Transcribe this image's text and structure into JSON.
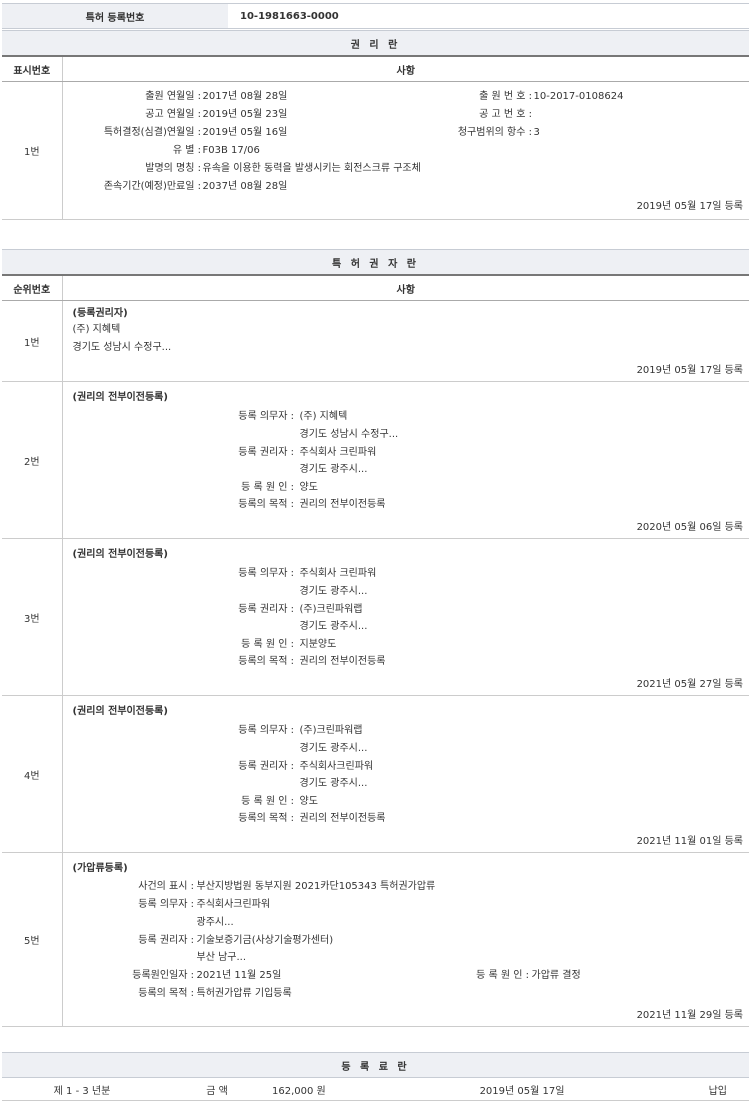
{
  "reg": {
    "label": "특허 등록번호",
    "value": "10-1981663-0000"
  },
  "rights": {
    "title": "권 리 란",
    "col1": "표시번호",
    "col2": "사항",
    "row": {
      "num": "1번",
      "filing_date_label": "출원 연월일 :",
      "filing_date": "2017년 08월 28일",
      "app_no_label": "출 원 번 호 :",
      "app_no": "10-2017-0108624",
      "pub_date_label": "공고 연월일 :",
      "pub_date": "2019년 05월 23일",
      "pub_no_label": "공 고 번 호 :",
      "pub_no": "",
      "decision_label": "특허결정(심결)연월일 :",
      "decision": "2019년 05월 16일",
      "claims_label": "청구범위의 항수 :",
      "claims": "3",
      "class_label": "유 별 :",
      "class": "F03B 17/06",
      "invention_label": "발명의 명칭 :",
      "invention": "유속을 이용한 동력을 발생시키는 회전스크류 구조체",
      "expiry_label": "존속기간(예정)만료일 :",
      "expiry": "2037년 08월 28일",
      "date": "2019년 05월 17일 등록"
    }
  },
  "holders": {
    "title": "특 허 권 자 란",
    "col1": "순위번호",
    "col2": "사항",
    "rows": [
      {
        "num": "1번",
        "head": "(등록권리자)",
        "name": "(주) 지혜텍",
        "addr": "경기도 성남시 수정구...",
        "date": "2019년 05월 17일 등록"
      },
      {
        "num": "2번",
        "head": "(권리의 전부이전등록)",
        "obligor_label": "등록 의무자 :",
        "obligor": "(주) 지혜텍",
        "obligor_addr": "경기도 성남시 수정구...",
        "holder_label": "등록 권리자 :",
        "holder": "주식회사 크린파워",
        "holder_addr": "경기도 광주시...",
        "cause_label": "등 록 원 인 :",
        "cause": "양도",
        "purpose_label": "등록의 목적 :",
        "purpose": "권리의 전부이전등록",
        "date": "2020년 05월 06일 등록"
      },
      {
        "num": "3번",
        "head": "(권리의 전부이전등록)",
        "obligor_label": "등록 의무자 :",
        "obligor": "주식회사 크린파워",
        "obligor_addr": "경기도 광주시...",
        "holder_label": "등록 권리자 :",
        "holder": "(주)크린파워랩",
        "holder_addr": "경기도 광주시...",
        "cause_label": "등 록 원 인 :",
        "cause": "지분양도",
        "purpose_label": "등록의 목적 :",
        "purpose": "권리의 전부이전등록",
        "date": "2021년 05월 27일 등록"
      },
      {
        "num": "4번",
        "head": "(권리의 전부이전등록)",
        "obligor_label": "등록 의무자 :",
        "obligor": "(주)크린파워랩",
        "obligor_addr": "경기도 광주시...",
        "holder_label": "등록 권리자 :",
        "holder": "주식회사크린파워",
        "holder_addr": "경기도 광주시...",
        "cause_label": "등 록 원 인 :",
        "cause": "양도",
        "purpose_label": "등록의 목적 :",
        "purpose": "권리의 전부이전등록",
        "date": "2021년 11월 01일 등록"
      },
      {
        "num": "5번",
        "head": "(가압류등록)",
        "case_label": "사건의 표시 :",
        "case": "부산지방법원 동부지원 2021카단105343 특허권가압류",
        "obligor_label": "등록 의무자 :",
        "obligor": "주식회사크린파워",
        "obligor_addr": "광주시...",
        "holder_label": "등록 권리자 :",
        "holder": "기술보증기금(사상기술평가센터)",
        "holder_addr": "부산 남구...",
        "causedate_label": "등록원인일자 :",
        "causedate": "2021년 11월 25일",
        "cause_label": "등 록 원 인 :",
        "cause": "가압류 결정",
        "purpose_label": "등록의 목적 :",
        "purpose": "특허권가압류 기입등록",
        "date": "2021년 11월 29일 등록"
      }
    ]
  },
  "fees": {
    "title": "등 록 료 란",
    "row": {
      "period": "제 1 - 3 년분",
      "amount_label": "금 액",
      "amount": "162,000 원",
      "date": "2019년 05월 17일",
      "status": "납입"
    }
  }
}
